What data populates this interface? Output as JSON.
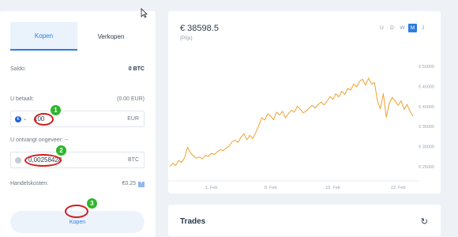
{
  "tabs": {
    "buy": "Kopen",
    "sell": "Verkopen"
  },
  "balance": {
    "label": "Saldo:",
    "value": "0 BTC"
  },
  "pay": {
    "label": "U betaalt:",
    "hint": "(0.00 EUR)",
    "currency_icon": "€",
    "amount": "100",
    "unit": "EUR"
  },
  "receive": {
    "label": "U ontvangt ongeveer: --",
    "amount": "0,00258428",
    "unit": "BTC"
  },
  "fees": {
    "label": "Handelskosten:",
    "value": "€0.25",
    "info_icon": "?"
  },
  "buy_button": "Kopen",
  "steps": [
    "1",
    "2",
    "3"
  ],
  "chart": {
    "price": "€ 38598.5",
    "subtitle": "(Prijs)",
    "ranges": [
      "U",
      "D",
      "W",
      "M",
      "J"
    ],
    "active_range": "M"
  },
  "trades": {
    "title": "Trades",
    "refresh_icon": "↻"
  },
  "chart_data": {
    "type": "line",
    "xlabel": "",
    "ylabel": "",
    "x_ticks": [
      "1. Feb",
      "8. Feb",
      "15. Feb",
      "22. Feb"
    ],
    "y_ticks": [
      "€ 50000",
      "€ 45000",
      "€ 40000",
      "€ 35000",
      "€ 30000",
      "€ 25000"
    ],
    "ylim": [
      22000,
      52000
    ],
    "color": "#f0a030",
    "values": [
      25000,
      25800,
      25300,
      26500,
      26000,
      27200,
      29800,
      28400,
      27600,
      27100,
      27400,
      26900,
      27800,
      27500,
      28300,
      28000,
      28700,
      29200,
      29000,
      29600,
      30100,
      31200,
      31600,
      31000,
      32300,
      33200,
      31700,
      32800,
      32000,
      33500,
      35200,
      37200,
      36600,
      38200,
      37600,
      36700,
      38600,
      37900,
      38800,
      37200,
      38200,
      39100,
      38600,
      40100,
      39300,
      38400,
      38900,
      39600,
      40300,
      39600,
      40500,
      41100,
      40400,
      41300,
      42500,
      41800,
      43200,
      42400,
      43800,
      43000,
      44500,
      44100,
      45600,
      44900,
      46300,
      46800,
      45300,
      47100,
      45600,
      46000,
      41500,
      39400,
      43200,
      37300,
      40800,
      42300,
      41300,
      40300,
      41400,
      39300,
      40500,
      38800,
      37600
    ]
  }
}
